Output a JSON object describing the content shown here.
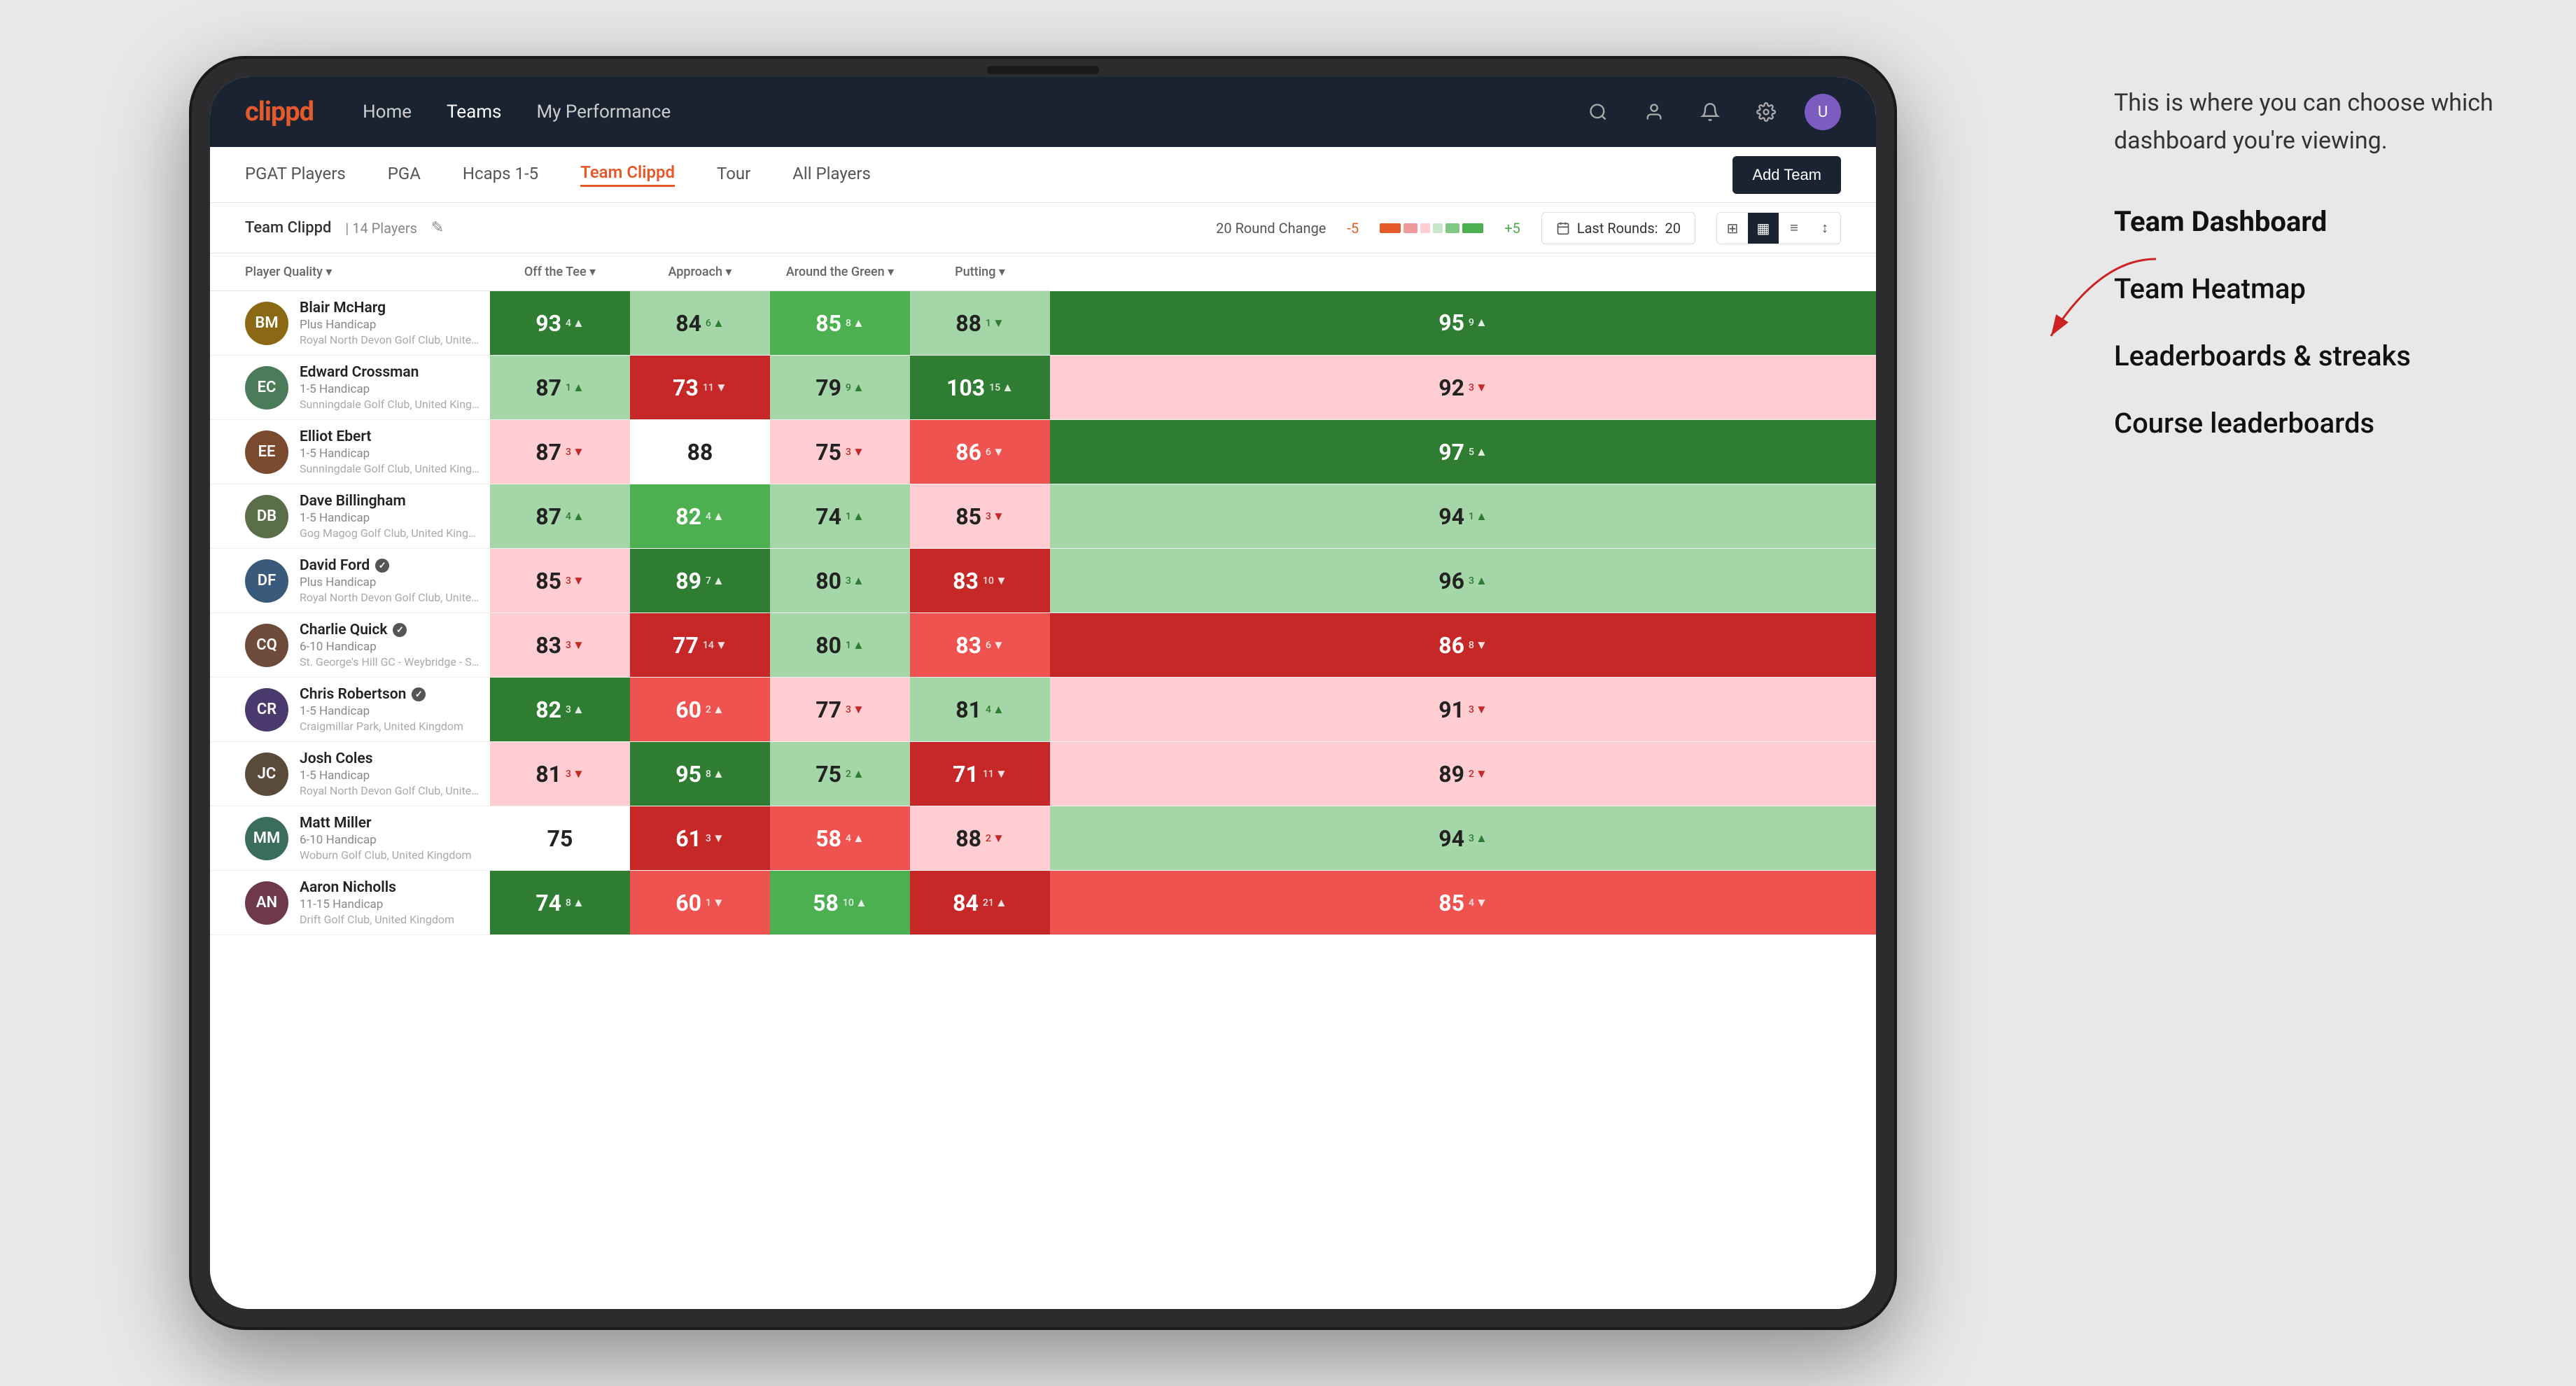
{
  "annotation": {
    "intro": "This is where you can choose which dashboard you're viewing.",
    "menu_items": [
      {
        "id": "team-dashboard",
        "label": "Team Dashboard",
        "active": true
      },
      {
        "id": "team-heatmap",
        "label": "Team Heatmap",
        "active": false
      },
      {
        "id": "leaderboards",
        "label": "Leaderboards & streaks",
        "active": false
      },
      {
        "id": "course-leaderboards",
        "label": "Course leaderboards",
        "active": false
      }
    ]
  },
  "nav": {
    "logo": "clippd",
    "items": [
      {
        "id": "home",
        "label": "Home"
      },
      {
        "id": "teams",
        "label": "Teams",
        "active": true
      },
      {
        "id": "my-performance",
        "label": "My Performance"
      }
    ]
  },
  "subnav": {
    "items": [
      {
        "id": "pgat-players",
        "label": "PGAT Players"
      },
      {
        "id": "pga",
        "label": "PGA"
      },
      {
        "id": "hcaps-1-5",
        "label": "Hcaps 1-5"
      },
      {
        "id": "team-clippd",
        "label": "Team Clippd",
        "active": true
      },
      {
        "id": "tour",
        "label": "Tour"
      },
      {
        "id": "all-players",
        "label": "All Players"
      }
    ],
    "add_team_label": "Add Team"
  },
  "team_bar": {
    "name": "Team Clippd",
    "separator": "|",
    "count": "14 Players",
    "round_change_label": "20 Round Change",
    "round_change_value": "-5",
    "plus_value": "+5",
    "last_rounds_label": "Last Rounds:",
    "last_rounds_value": "20"
  },
  "table": {
    "columns": [
      {
        "id": "player",
        "label": "Player Quality ▾"
      },
      {
        "id": "off-tee",
        "label": "Off the Tee ▾"
      },
      {
        "id": "approach",
        "label": "Approach ▾"
      },
      {
        "id": "around-green",
        "label": "Around the Green ▾"
      },
      {
        "id": "putting",
        "label": "Putting ▾"
      }
    ],
    "rows": [
      {
        "id": "blair-mcharg",
        "name": "Blair McHarg",
        "handicap": "Plus Handicap",
        "club": "Royal North Devon Golf Club, United Kingdom",
        "avatar_color": "#8B6914",
        "avatar_initials": "BM",
        "player_quality": {
          "value": 93,
          "change": 4,
          "dir": "up",
          "bg": "bg-green-dark"
        },
        "off_tee": {
          "value": 84,
          "change": 6,
          "dir": "up",
          "bg": "bg-green-light"
        },
        "approach": {
          "value": 85,
          "change": 8,
          "dir": "up",
          "bg": "bg-green-mid"
        },
        "around_green": {
          "value": 88,
          "change": 1,
          "dir": "down",
          "bg": "bg-green-light"
        },
        "putting": {
          "value": 95,
          "change": 9,
          "dir": "up",
          "bg": "bg-green-dark"
        }
      },
      {
        "id": "edward-crossman",
        "name": "Edward Crossman",
        "handicap": "1-5 Handicap",
        "club": "Sunningdale Golf Club, United Kingdom",
        "avatar_color": "#4a7c59",
        "avatar_initials": "EC",
        "player_quality": {
          "value": 87,
          "change": 1,
          "dir": "up",
          "bg": "bg-green-light"
        },
        "off_tee": {
          "value": 73,
          "change": 11,
          "dir": "down",
          "bg": "bg-red-dark"
        },
        "approach": {
          "value": 79,
          "change": 9,
          "dir": "up",
          "bg": "bg-green-light"
        },
        "around_green": {
          "value": 103,
          "change": 15,
          "dir": "up",
          "bg": "bg-green-dark"
        },
        "putting": {
          "value": 92,
          "change": 3,
          "dir": "down",
          "bg": "bg-red-light"
        }
      },
      {
        "id": "elliot-ebert",
        "name": "Elliot Ebert",
        "handicap": "1-5 Handicap",
        "club": "Sunningdale Golf Club, United Kingdom",
        "avatar_color": "#7b4a2e",
        "avatar_initials": "EE",
        "player_quality": {
          "value": 87,
          "change": 3,
          "dir": "down",
          "bg": "bg-red-light"
        },
        "off_tee": {
          "value": 88,
          "change": 0,
          "dir": "neutral",
          "bg": "bg-white"
        },
        "approach": {
          "value": 75,
          "change": 3,
          "dir": "down",
          "bg": "bg-red-light"
        },
        "around_green": {
          "value": 86,
          "change": 6,
          "dir": "down",
          "bg": "bg-red-mid"
        },
        "putting": {
          "value": 97,
          "change": 5,
          "dir": "up",
          "bg": "bg-green-dark"
        }
      },
      {
        "id": "dave-billingham",
        "name": "Dave Billingham",
        "handicap": "1-5 Handicap",
        "club": "Gog Magog Golf Club, United Kingdom",
        "avatar_color": "#5a6e4a",
        "avatar_initials": "DB",
        "player_quality": {
          "value": 87,
          "change": 4,
          "dir": "up",
          "bg": "bg-green-light"
        },
        "off_tee": {
          "value": 82,
          "change": 4,
          "dir": "up",
          "bg": "bg-green-mid"
        },
        "approach": {
          "value": 74,
          "change": 1,
          "dir": "up",
          "bg": "bg-green-light"
        },
        "around_green": {
          "value": 85,
          "change": 3,
          "dir": "down",
          "bg": "bg-red-light"
        },
        "putting": {
          "value": 94,
          "change": 1,
          "dir": "up",
          "bg": "bg-green-light"
        }
      },
      {
        "id": "david-ford",
        "name": "David Ford",
        "handicap": "Plus Handicap",
        "club": "Royal North Devon Golf Club, United Kingdom",
        "avatar_color": "#3a5a7c",
        "avatar_initials": "DF",
        "has_badge": true,
        "player_quality": {
          "value": 85,
          "change": 3,
          "dir": "down",
          "bg": "bg-red-light"
        },
        "off_tee": {
          "value": 89,
          "change": 7,
          "dir": "up",
          "bg": "bg-green-dark"
        },
        "approach": {
          "value": 80,
          "change": 3,
          "dir": "up",
          "bg": "bg-green-light"
        },
        "around_green": {
          "value": 83,
          "change": 10,
          "dir": "down",
          "bg": "bg-red-dark"
        },
        "putting": {
          "value": 96,
          "change": 3,
          "dir": "up",
          "bg": "bg-green-light"
        }
      },
      {
        "id": "charlie-quick",
        "name": "Charlie Quick",
        "handicap": "6-10 Handicap",
        "club": "St. George's Hill GC - Weybridge - Surrey, Uni...",
        "avatar_color": "#6e4a3a",
        "avatar_initials": "CQ",
        "has_badge": true,
        "player_quality": {
          "value": 83,
          "change": 3,
          "dir": "down",
          "bg": "bg-red-light"
        },
        "off_tee": {
          "value": 77,
          "change": 14,
          "dir": "down",
          "bg": "bg-red-dark"
        },
        "approach": {
          "value": 80,
          "change": 1,
          "dir": "up",
          "bg": "bg-green-light"
        },
        "around_green": {
          "value": 83,
          "change": 6,
          "dir": "down",
          "bg": "bg-red-mid"
        },
        "putting": {
          "value": 86,
          "change": 8,
          "dir": "down",
          "bg": "bg-red-dark"
        }
      },
      {
        "id": "chris-robertson",
        "name": "Chris Robertson",
        "handicap": "1-5 Handicap",
        "club": "Craigmillar Park, United Kingdom",
        "avatar_color": "#4a3a6e",
        "avatar_initials": "CR",
        "has_badge": true,
        "player_quality": {
          "value": 82,
          "change": 3,
          "dir": "up",
          "bg": "bg-green-dark"
        },
        "off_tee": {
          "value": 60,
          "change": 2,
          "dir": "up",
          "bg": "bg-red-mid"
        },
        "approach": {
          "value": 77,
          "change": 3,
          "dir": "down",
          "bg": "bg-red-light"
        },
        "around_green": {
          "value": 81,
          "change": 4,
          "dir": "up",
          "bg": "bg-green-light"
        },
        "putting": {
          "value": 91,
          "change": 3,
          "dir": "down",
          "bg": "bg-red-light"
        }
      },
      {
        "id": "josh-coles",
        "name": "Josh Coles",
        "handicap": "1-5 Handicap",
        "club": "Royal North Devon Golf Club, United Kingdom",
        "avatar_color": "#5a4a3a",
        "avatar_initials": "JC",
        "player_quality": {
          "value": 81,
          "change": 3,
          "dir": "down",
          "bg": "bg-red-light"
        },
        "off_tee": {
          "value": 95,
          "change": 8,
          "dir": "up",
          "bg": "bg-green-dark"
        },
        "approach": {
          "value": 75,
          "change": 2,
          "dir": "up",
          "bg": "bg-green-light"
        },
        "around_green": {
          "value": 71,
          "change": 11,
          "dir": "down",
          "bg": "bg-red-dark"
        },
        "putting": {
          "value": 89,
          "change": 2,
          "dir": "down",
          "bg": "bg-red-light"
        }
      },
      {
        "id": "matt-miller",
        "name": "Matt Miller",
        "handicap": "6-10 Handicap",
        "club": "Woburn Golf Club, United Kingdom",
        "avatar_color": "#3a6e5a",
        "avatar_initials": "MM",
        "player_quality": {
          "value": 75,
          "change": 0,
          "dir": "neutral",
          "bg": "bg-white"
        },
        "off_tee": {
          "value": 61,
          "change": 3,
          "dir": "down",
          "bg": "bg-red-dark"
        },
        "approach": {
          "value": 58,
          "change": 4,
          "dir": "up",
          "bg": "bg-red-mid"
        },
        "around_green": {
          "value": 88,
          "change": 2,
          "dir": "down",
          "bg": "bg-red-light"
        },
        "putting": {
          "value": 94,
          "change": 3,
          "dir": "up",
          "bg": "bg-green-light"
        }
      },
      {
        "id": "aaron-nicholls",
        "name": "Aaron Nicholls",
        "handicap": "11-15 Handicap",
        "club": "Drift Golf Club, United Kingdom",
        "avatar_color": "#6e3a4a",
        "avatar_initials": "AN",
        "player_quality": {
          "value": 74,
          "change": 8,
          "dir": "up",
          "bg": "bg-green-dark"
        },
        "off_tee": {
          "value": 60,
          "change": 1,
          "dir": "down",
          "bg": "bg-red-mid"
        },
        "approach": {
          "value": 58,
          "change": 10,
          "dir": "up",
          "bg": "bg-green-mid"
        },
        "around_green": {
          "value": 84,
          "change": 21,
          "dir": "up",
          "bg": "bg-red-dark"
        },
        "putting": {
          "value": 85,
          "change": 4,
          "dir": "down",
          "bg": "bg-red-mid"
        }
      }
    ]
  },
  "icons": {
    "search": "🔍",
    "user": "👤",
    "bell": "🔔",
    "settings": "⚙",
    "edit": "✎",
    "grid": "⊞",
    "list": "≡",
    "sort": "⇅"
  }
}
